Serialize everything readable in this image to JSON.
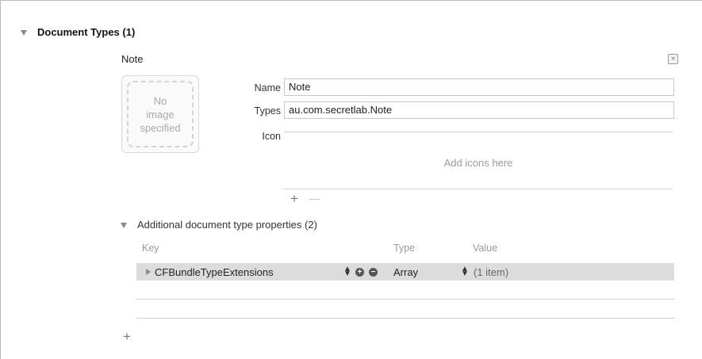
{
  "section": {
    "title": "Document Types (1)"
  },
  "document": {
    "heading": "Note",
    "image_well_text": "No\nimage\nspecified",
    "name_label": "Name",
    "name_value": "Note",
    "types_label": "Types",
    "types_value": "au.com.secretlab.Note",
    "icon_label": "Icon",
    "icons_placeholder": "Add icons here",
    "add_symbol": "+",
    "remove_symbol": "—"
  },
  "additional": {
    "title": "Additional document type properties (2)",
    "columns": {
      "key": "Key",
      "type": "Type",
      "value": "Value"
    },
    "rows": [
      {
        "key": "CFBundleTypeExtensions",
        "type": "Array",
        "value": "(1 item)"
      }
    ],
    "add_symbol": "+"
  },
  "icons": {
    "section_disclosure": "disclosure-triangle-down-icon",
    "close": "close-box-icon",
    "row_disclosure": "disclosure-triangle-right-icon",
    "add_row": "plus-circle-icon",
    "remove_row": "minus-circle-icon",
    "stepper": "up-down-stepper-icon"
  },
  "colors": {
    "selected_row": "#dcdcdc",
    "muted_text": "#9a9a9a",
    "border": "#c8c8c8"
  }
}
